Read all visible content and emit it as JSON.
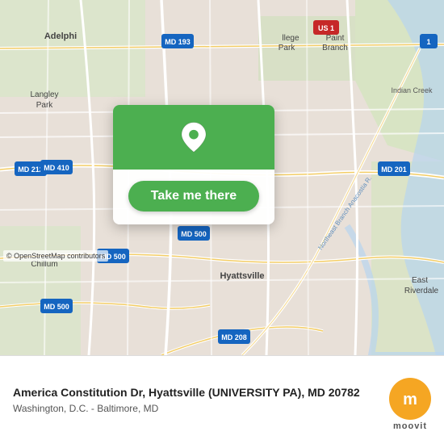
{
  "map": {
    "attribution": "© OpenStreetMap contributors"
  },
  "overlay": {
    "button_label": "Take me there"
  },
  "bottom_bar": {
    "address_main": "America Constitution Dr, Hyattsville (UNIVERSITY PA), MD 20782",
    "address_sub": "Washington, D.C. - Baltimore, MD"
  },
  "logo": {
    "icon": "m",
    "label": "moovit"
  }
}
